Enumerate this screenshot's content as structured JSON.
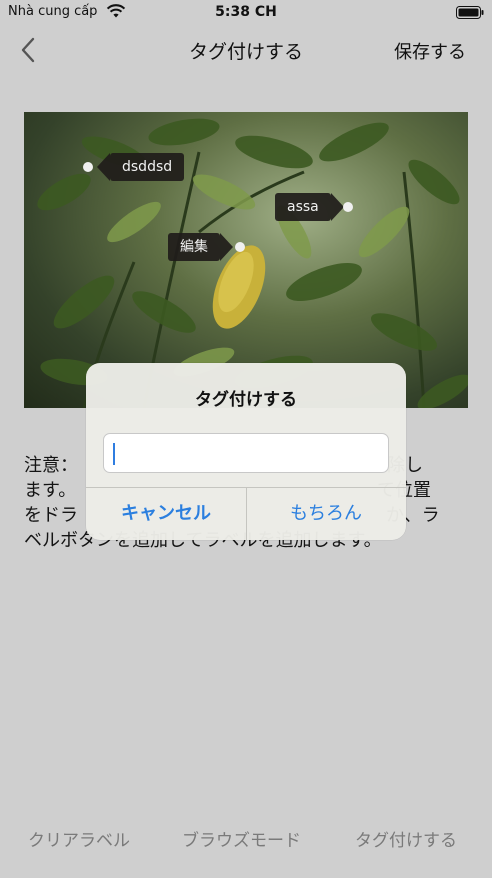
{
  "status_bar": {
    "carrier": "Nhà cung cấp",
    "time": "5:38 CH",
    "wifi_icon": "wifi-icon",
    "battery_icon": "battery-icon"
  },
  "nav": {
    "back_icon": "chevron-left-icon",
    "title": "タグ付けする",
    "save_label": "保存する"
  },
  "photo": {
    "tags": [
      {
        "label": "dsddsd"
      },
      {
        "label": "assa"
      },
      {
        "label": "編集"
      }
    ]
  },
  "note": {
    "lines": [
      "注意：",
      "ます。",
      "をドラ",
      "ベルボタン"
    ],
    "line1_end": "削除し",
    "line2_end": "て位置",
    "line3_end": "か、ラ",
    "line4_end": "を追加してラベルを追加します。"
  },
  "alert": {
    "title": "タグ付けする",
    "input_value": "",
    "input_placeholder": "",
    "cancel_label": "キャンセル",
    "ok_label": "もちろん"
  },
  "bottom_bar": {
    "clear_label": "クリアラベル",
    "browse_label": "ブラウズモード",
    "tag_label": "タグ付けする"
  },
  "colors": {
    "accent": "#2b7fdf",
    "dim_text": "#7a7a7a",
    "background": "#cfcfcf"
  }
}
